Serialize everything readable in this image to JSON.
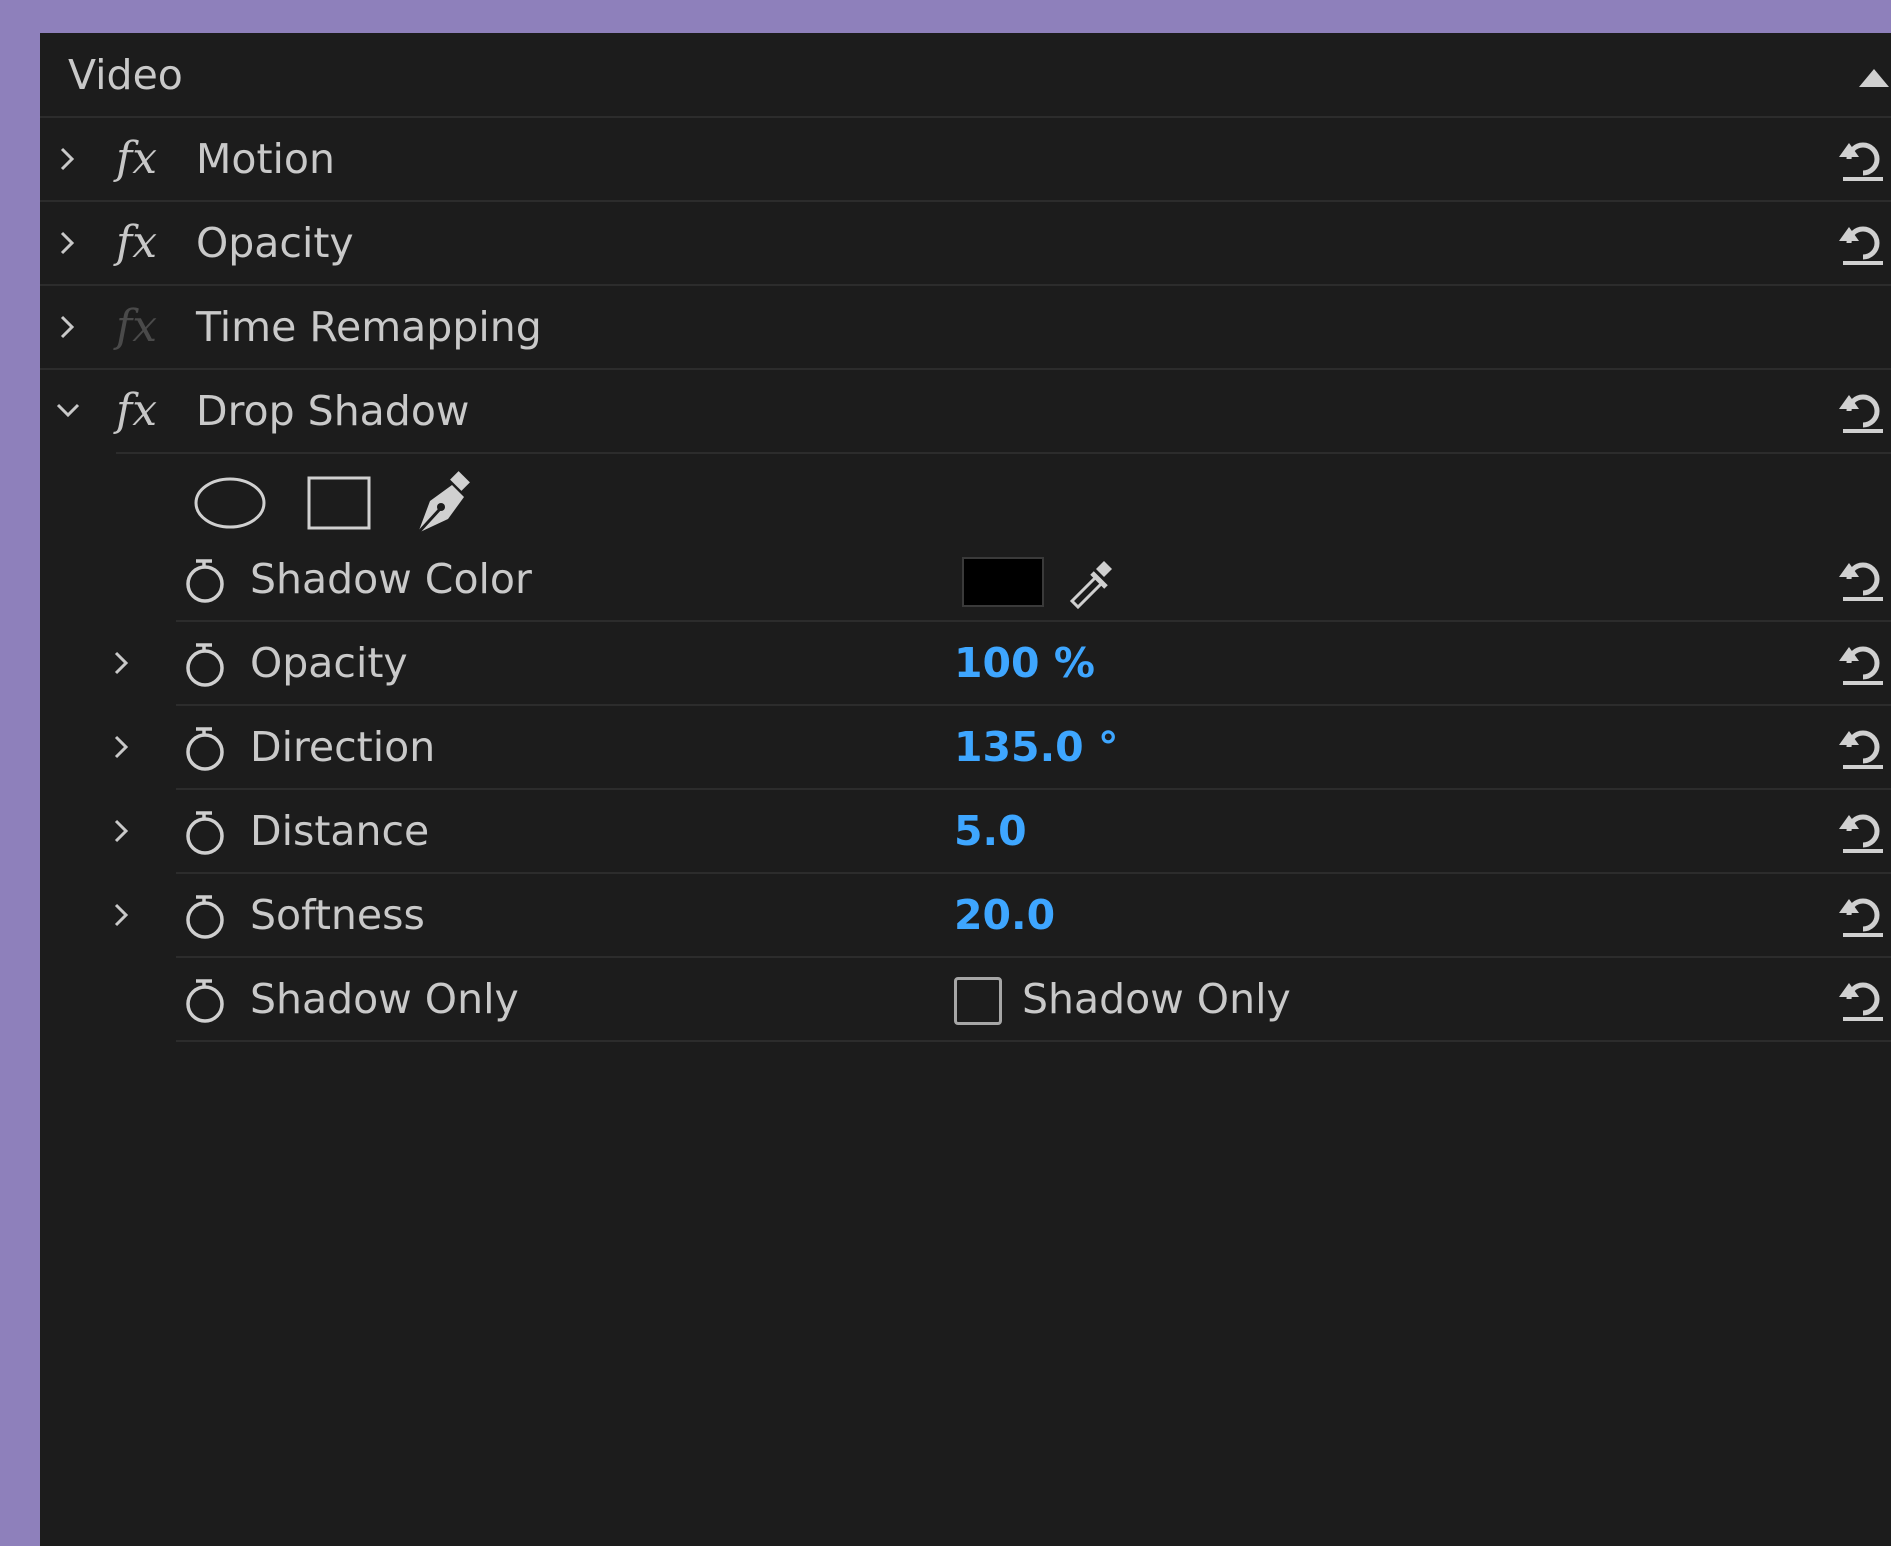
{
  "section": {
    "title": "Video"
  },
  "effects": [
    {
      "name": "Motion",
      "expanded": false,
      "fx_enabled": true,
      "has_reset": true
    },
    {
      "name": "Opacity",
      "expanded": false,
      "fx_enabled": true,
      "has_reset": true
    },
    {
      "name": "Time Remapping",
      "expanded": false,
      "fx_enabled": false,
      "has_reset": false
    },
    {
      "name": "Drop Shadow",
      "expanded": true,
      "fx_enabled": true,
      "has_reset": true
    }
  ],
  "fx_symbol": "fx",
  "drop_shadow": {
    "mask_tools": [
      "ellipse-mask-icon",
      "rectangle-mask-icon",
      "pen-mask-icon"
    ],
    "params": {
      "shadow_color": {
        "label": "Shadow Color",
        "color": "#000000"
      },
      "opacity": {
        "label": "Opacity",
        "value": "100 %"
      },
      "direction": {
        "label": "Direction",
        "value": "135.0 °"
      },
      "distance": {
        "label": "Distance",
        "value": "5.0"
      },
      "softness": {
        "label": "Softness",
        "value": "20.0"
      },
      "shadow_only": {
        "label": "Shadow Only",
        "checkbox_label": "Shadow Only",
        "checked": false
      }
    }
  },
  "colors": {
    "frame": "#8e80bb",
    "panel": "#1c1c1c",
    "value_blue": "#3ea6ff",
    "text": "#c9c9c9"
  }
}
